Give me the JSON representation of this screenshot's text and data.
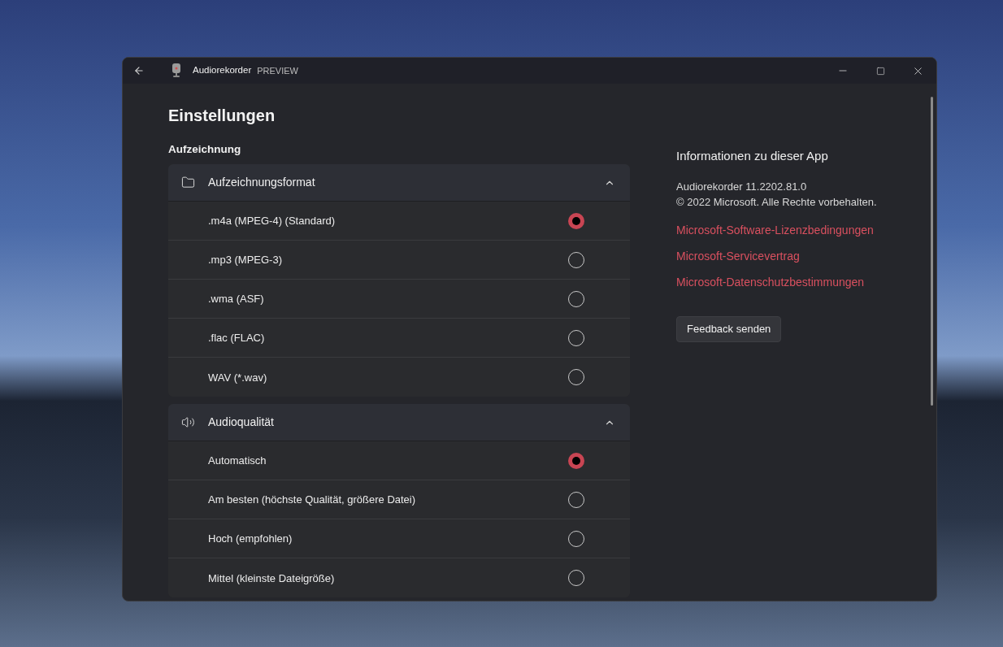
{
  "window": {
    "title": "Audiorekorder",
    "badge": "PREVIEW"
  },
  "page_title": "Einstellungen",
  "section_heading": "Aufzeichnung",
  "groups": [
    {
      "kind": "folder",
      "title": "Aufzeichnungsformat",
      "expanded": true,
      "options": [
        {
          "label": ".m4a (MPEG-4) (Standard)",
          "selected": true
        },
        {
          "label": ".mp3 (MPEG-3)",
          "selected": false
        },
        {
          "label": ".wma (ASF)",
          "selected": false
        },
        {
          "label": ".flac (FLAC)",
          "selected": false
        },
        {
          "label": "WAV (*.wav)",
          "selected": false
        }
      ]
    },
    {
      "kind": "speaker",
      "title": "Audioqualität",
      "expanded": true,
      "options": [
        {
          "label": "Automatisch",
          "selected": true
        },
        {
          "label": "Am besten (höchste Qualität, größere Datei)",
          "selected": false
        },
        {
          "label": "Hoch (empfohlen)",
          "selected": false
        },
        {
          "label": "Mittel (kleinste Dateigröße)",
          "selected": false
        }
      ]
    }
  ],
  "about": {
    "heading": "Informationen zu dieser App",
    "version": "Audiorekorder 11.2202.81.0",
    "copyright": "© 2022 Microsoft. Alle Rechte vorbehalten.",
    "links": [
      "Microsoft-Software-Lizenzbedingungen",
      "Microsoft-Servicevertrag",
      "Microsoft-Datenschutzbestimmungen"
    ],
    "button": "Feedback senden"
  }
}
